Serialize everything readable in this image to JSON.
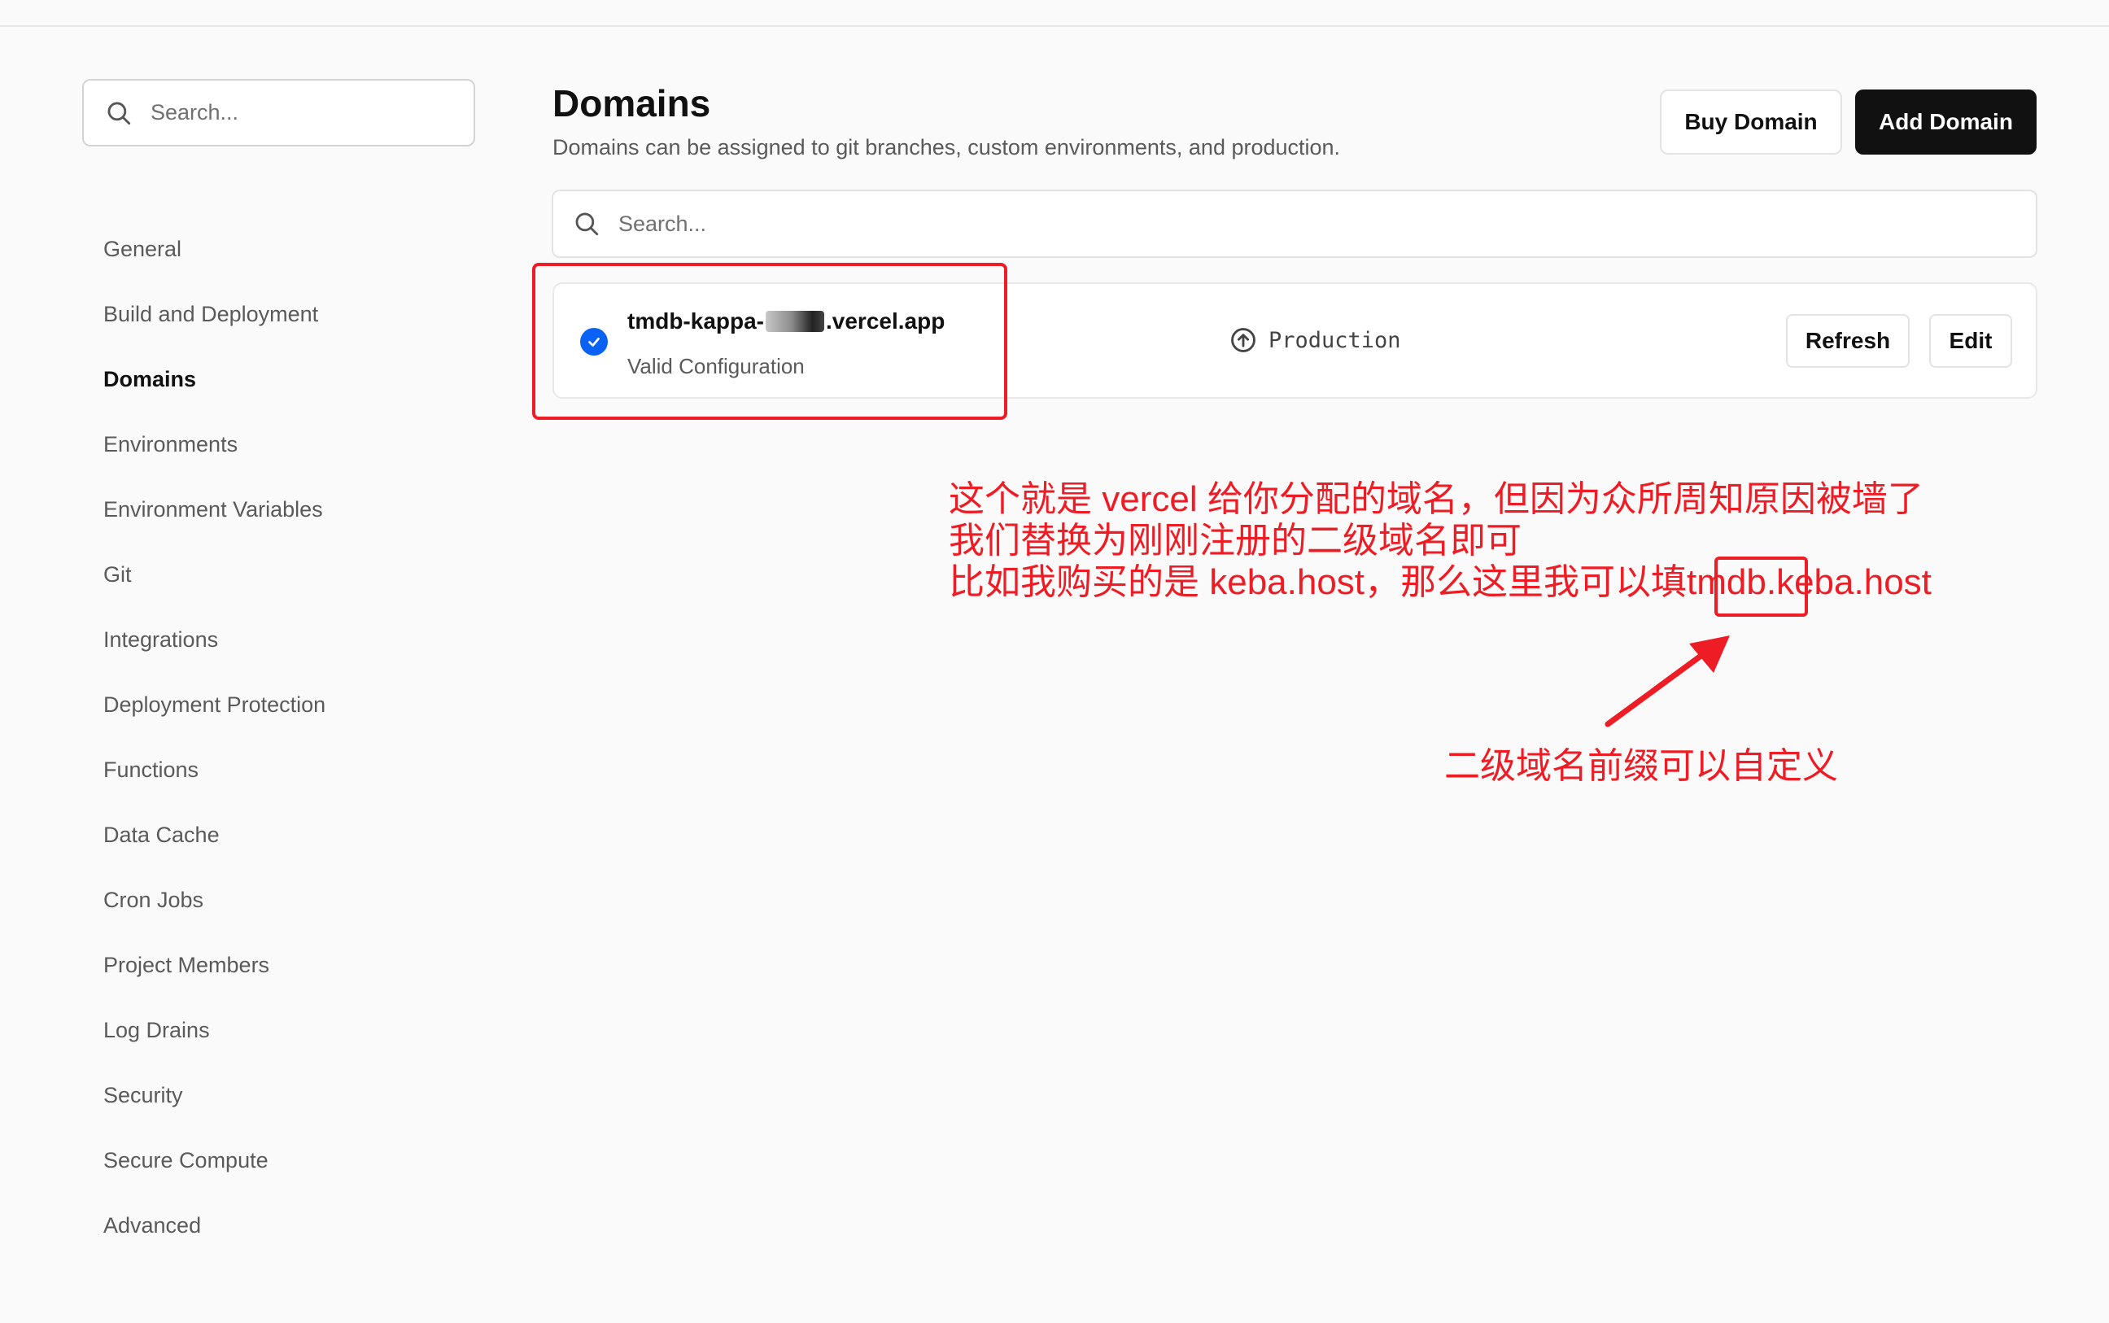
{
  "sidebar": {
    "search_placeholder": "Search...",
    "items": [
      {
        "label": "General"
      },
      {
        "label": "Build and Deployment"
      },
      {
        "label": "Domains"
      },
      {
        "label": "Environments"
      },
      {
        "label": "Environment Variables"
      },
      {
        "label": "Git"
      },
      {
        "label": "Integrations"
      },
      {
        "label": "Deployment Protection"
      },
      {
        "label": "Functions"
      },
      {
        "label": "Data Cache"
      },
      {
        "label": "Cron Jobs"
      },
      {
        "label": "Project Members"
      },
      {
        "label": "Log Drains"
      },
      {
        "label": "Security"
      },
      {
        "label": "Secure Compute"
      },
      {
        "label": "Advanced"
      }
    ],
    "active": "Domains"
  },
  "header": {
    "title": "Domains",
    "subtitle": "Domains can be assigned to git branches, custom environments, and production.",
    "buy_label": "Buy Domain",
    "add_label": "Add Domain"
  },
  "main": {
    "search_placeholder": "Search..."
  },
  "domain": {
    "name_prefix": "tmdb-kappa-",
    "name_suffix": ".vercel.app",
    "status": "Valid Configuration",
    "environment": "Production",
    "refresh_label": "Refresh",
    "edit_label": "Edit"
  },
  "annotations": {
    "line1": "这个就是 vercel 给你分配的域名，但因为众所周知原因被墙了",
    "line2": "我们替换为刚刚注册的二级域名即可",
    "line3_prefix": "比如我购买的是 keba.host，那么这里我可以填",
    "line3_highlight": "tmdb",
    "line3_suffix": ".keba.host",
    "bottom_note": "二级域名前缀可以自定义",
    "color": "#ee1c24"
  }
}
